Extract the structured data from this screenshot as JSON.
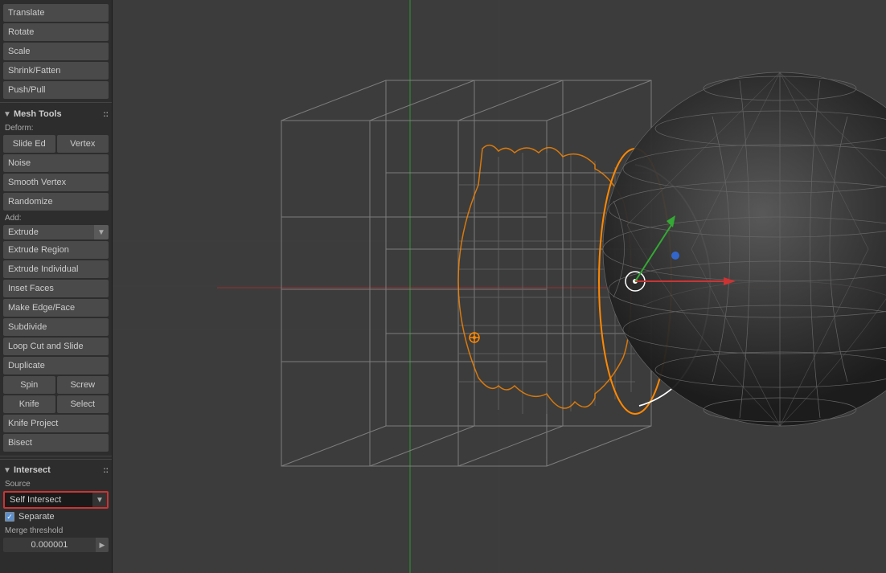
{
  "toolbar": {
    "top_buttons": [
      "Translate",
      "Rotate",
      "Scale",
      "Shrink/Fatten",
      "Push/Pull"
    ]
  },
  "mesh_tools": {
    "header": "Mesh Tools",
    "deform_label": "Deform:",
    "deform_buttons": [
      {
        "label": "Slide Ed",
        "type": "btn"
      },
      {
        "label": "Vertex",
        "type": "btn"
      }
    ],
    "noise_btn": "Noise",
    "smooth_vertex_btn": "Smooth Vertex",
    "randomize_btn": "Randomize",
    "add_label": "Add:",
    "extrude_dropdown": "Extrude",
    "extrude_region_btn": "Extrude Region",
    "extrude_individual_btn": "Extrude Individual",
    "inset_faces_btn": "Inset Faces",
    "make_edge_face_btn": "Make Edge/Face",
    "subdivide_btn": "Subdivide",
    "loop_cut_btn": "Loop Cut and Slide",
    "duplicate_btn": "Duplicate",
    "spin_btn": "Spin",
    "screw_btn": "Screw",
    "knife_btn": "Knife",
    "select_btn": "Select",
    "knife_project_btn": "Knife Project",
    "bisect_btn": "Bisect"
  },
  "intersect": {
    "header": "Intersect",
    "source_label": "Source",
    "dropdown_value": "Self Intersect",
    "separate_label": "Separate",
    "separate_checked": true,
    "merge_threshold_label": "Merge threshold",
    "merge_threshold_value": "0.000001"
  }
}
